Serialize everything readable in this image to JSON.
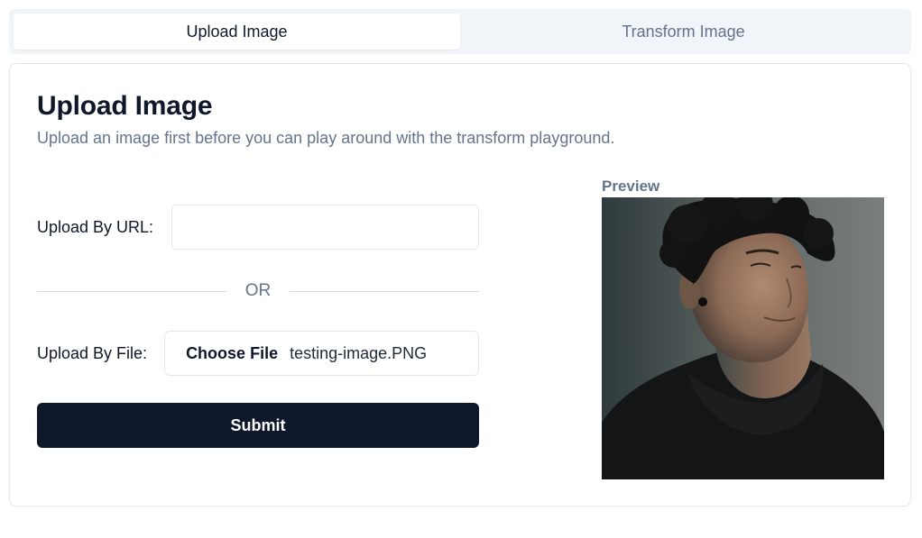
{
  "tabs": [
    {
      "label": "Upload Image",
      "active": true
    },
    {
      "label": "Transform Image",
      "active": false
    }
  ],
  "card": {
    "title": "Upload Image",
    "description": "Upload an image first before you can play around with the transform playground."
  },
  "form": {
    "url_label": "Upload By URL:",
    "url_value": "",
    "url_placeholder": "",
    "or_text": "OR",
    "file_label": "Upload By File:",
    "choose_file_label": "Choose File",
    "file_name": "testing-image.PNG",
    "submit_label": "Submit"
  },
  "preview": {
    "label": "Preview",
    "image_alt": "portrait-photo"
  },
  "colors": {
    "primary": "#0f172a",
    "muted_text": "#64748b",
    "border": "#e2e8f0",
    "tab_bg": "#f1f5f9"
  }
}
